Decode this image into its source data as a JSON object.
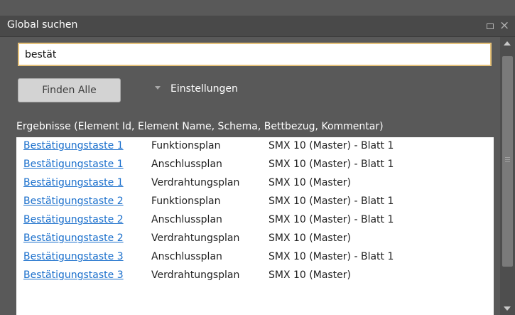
{
  "panel": {
    "title": "Global suchen",
    "restore_icon": "restore-icon",
    "close_icon": "close-icon",
    "close_glyph": "×"
  },
  "search": {
    "value": "bestät"
  },
  "toolbar": {
    "find_all_label": "Finden Alle",
    "settings_label": "Einstellungen",
    "settings_icon": "triangle-down-icon"
  },
  "results": {
    "header": "Ergebnisse (Element Id, Element Name, Schema, Bettbezug, Kommentar)",
    "rows": [
      {
        "id": "Bestätigungstaste 1",
        "name": "Funktionsplan",
        "schema": "SMX 10 (Master) - Blatt 1"
      },
      {
        "id": "Bestätigungstaste 1",
        "name": "Anschlussplan",
        "schema": "SMX 10 (Master) - Blatt 1"
      },
      {
        "id": "Bestätigungstaste 1",
        "name": "Verdrahtungsplan",
        "schema": "SMX 10 (Master)"
      },
      {
        "id": "Bestätigungstaste 2",
        "name": "Funktionsplan",
        "schema": "SMX 10 (Master) - Blatt 1"
      },
      {
        "id": "Bestätigungstaste 2",
        "name": "Anschlussplan",
        "schema": "SMX 10 (Master) - Blatt 1"
      },
      {
        "id": "Bestätigungstaste 2",
        "name": "Verdrahtungsplan",
        "schema": "SMX 10 (Master)"
      },
      {
        "id": "Bestätigungstaste 3",
        "name": "Anschlussplan",
        "schema": "SMX 10 (Master) - Blatt 1"
      },
      {
        "id": "Bestätigungstaste 3",
        "name": "Verdrahtungsplan",
        "schema": "SMX 10 (Master)"
      }
    ]
  },
  "colors": {
    "panel_bg": "#595959",
    "titlebar_bg": "#494949",
    "input_border": "#e6c27a",
    "link": "#1a6fcc",
    "button_bg": "#d3d3d3"
  }
}
